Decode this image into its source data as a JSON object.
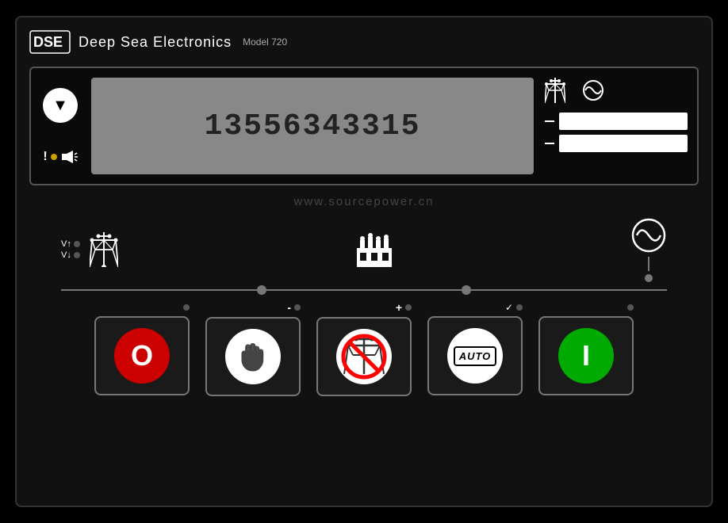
{
  "header": {
    "brand": "Deep Sea Electronics",
    "model": "Model 720",
    "logo_text": "DSE"
  },
  "display": {
    "phone_number": "13556343315"
  },
  "watermark": {
    "url": "www.sourcepower.cn"
  },
  "v_labels": {
    "v_up": "V↑",
    "v_down": "V↓"
  },
  "buttons": [
    {
      "id": "off",
      "label": "O",
      "type": "off"
    },
    {
      "id": "stop",
      "label": "✋",
      "type": "stop"
    },
    {
      "id": "gridoff",
      "label": "",
      "type": "gridoff"
    },
    {
      "id": "auto",
      "label": "AUTO",
      "type": "auto"
    },
    {
      "id": "on",
      "label": "I",
      "type": "on"
    }
  ],
  "btn_indicators": {
    "stop_minus": "-",
    "gridoff_plus": "+",
    "auto_check": "✓"
  }
}
